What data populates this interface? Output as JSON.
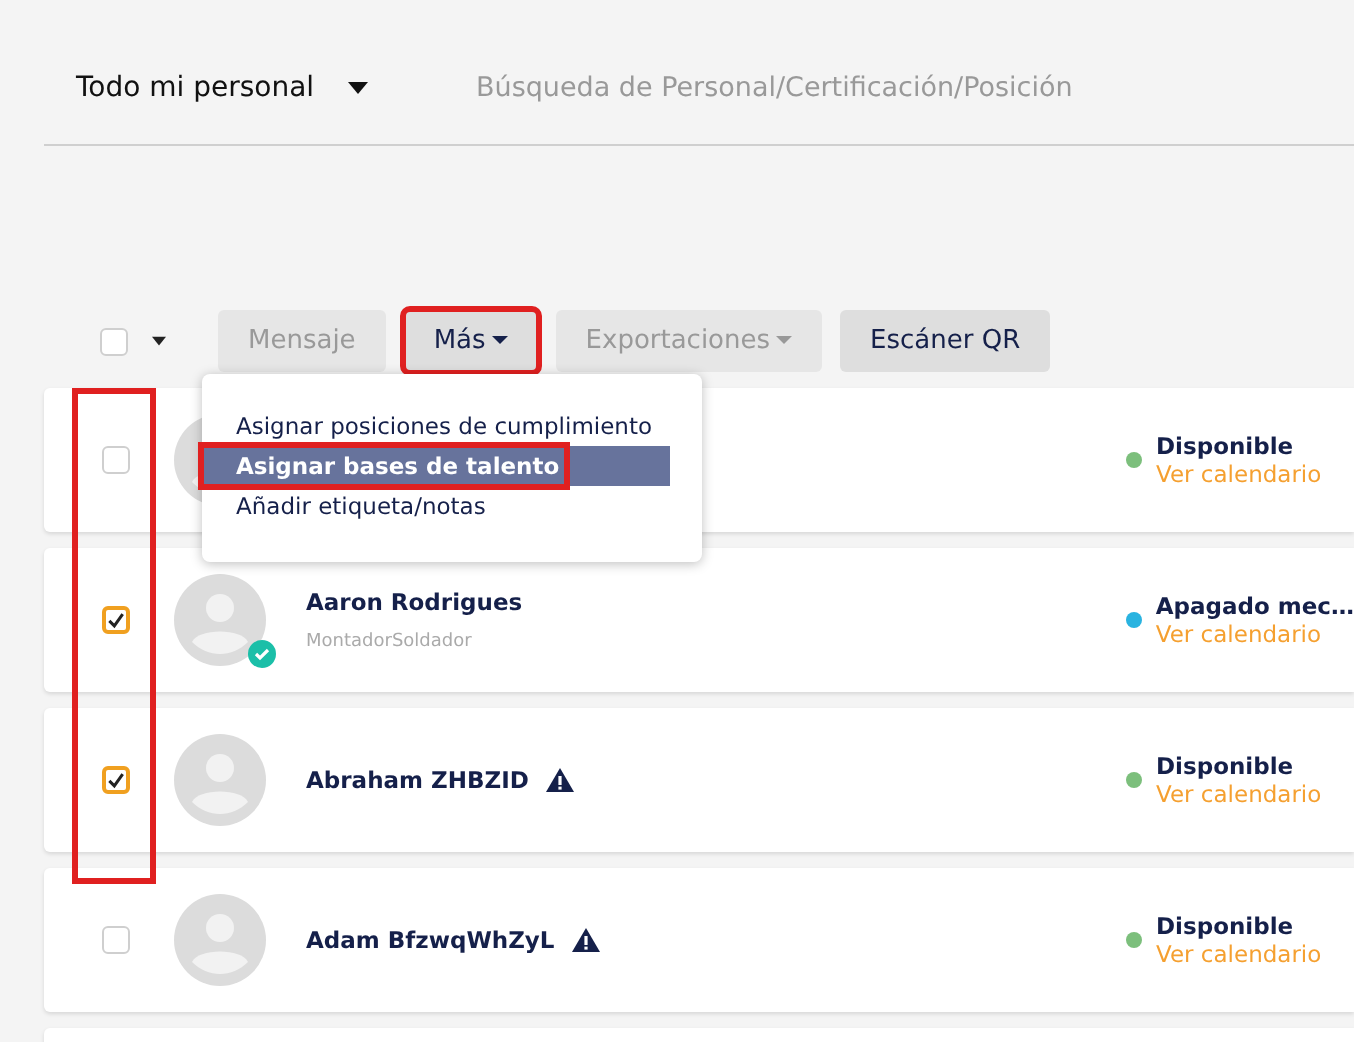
{
  "header": {
    "filter": {
      "label": "Todo mi personal"
    },
    "search": {
      "placeholder": "Búsqueda de Personal/Certificación/Posición"
    }
  },
  "toolbar": {
    "select_all": {
      "checked": false
    },
    "buttons": [
      {
        "label": "Mensaje",
        "disabled": true,
        "dropdown": false,
        "highlighted": false
      },
      {
        "label": "Más",
        "disabled": false,
        "dropdown": true,
        "highlighted": true
      },
      {
        "label": "Exportaciones",
        "disabled": true,
        "dropdown": true,
        "highlighted": false
      },
      {
        "label": "Escáner QR",
        "disabled": false,
        "dropdown": false,
        "highlighted": false
      }
    ]
  },
  "menu": {
    "items": [
      {
        "label": "Asignar posiciones de cumplimiento",
        "selected": false,
        "highlighted": false
      },
      {
        "label": "Asignar bases de talento",
        "selected": true,
        "highlighted": true
      },
      {
        "label": "Añadir etiqueta/notas",
        "selected": false,
        "highlighted": false
      }
    ]
  },
  "list": {
    "checkbox_column_highlighted": true,
    "rows": [
      {
        "checked": false,
        "verified": false,
        "warning": false,
        "status": "Disponible",
        "color": "#7cbf7c",
        "link": "Ver calendario"
      },
      {
        "name": "Aaron Rodrigues",
        "role": "MontadorSoldador",
        "checked": true,
        "verified": true,
        "warning": false,
        "status": "Apagado mec…",
        "color": "#29b3e0",
        "link": "Ver calendario"
      },
      {
        "name": "Abraham ZHBZID",
        "checked": true,
        "verified": false,
        "warning": true,
        "status": "Disponible",
        "color": "#7cbf7c",
        "link": "Ver calendario"
      },
      {
        "name": "Adam BfzwqWhZyL",
        "checked": false,
        "verified": false,
        "warning": true,
        "status": "Disponible",
        "color": "#7cbf7c",
        "link": "Ver calendario"
      }
    ]
  }
}
